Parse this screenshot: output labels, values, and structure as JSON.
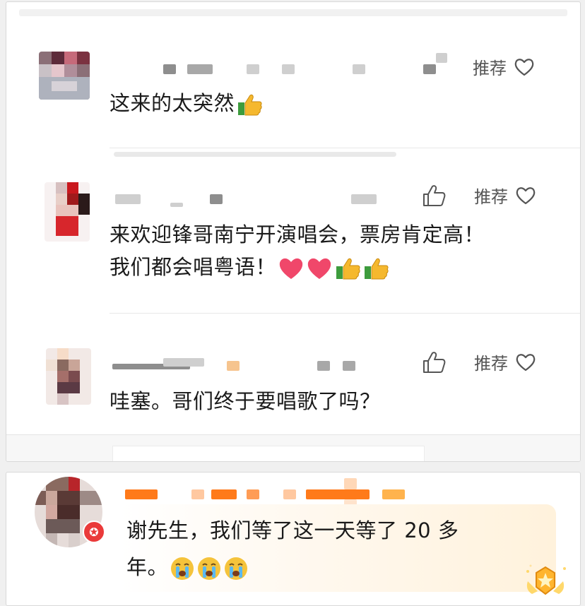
{
  "actions": {
    "like_icon": "thumbs-up-outline",
    "recommend_label": "推荐",
    "heart_icon": "heart-outline"
  },
  "comments": [
    {
      "text": "这来的太突然",
      "emoji": [
        "thumbs-up"
      ]
    },
    {
      "line1": "来欢迎锋哥南宁开演唱会，票房肯定高！",
      "line2": "我们都会唱粤语！",
      "emoji": [
        "red-heart",
        "red-heart",
        "thumbs-up",
        "thumbs-up"
      ]
    },
    {
      "text": "哇塞。哥们终于要唱歌了吗？"
    }
  ],
  "featured": {
    "line1": "谢先生，我们等了这一天等了 20 多",
    "line2": "年。",
    "emoji": [
      "crying-face",
      "crying-face",
      "crying-face"
    ],
    "badge_icon": "verified-v-icon",
    "medal_icon": "crown-medal-icon"
  },
  "colors": {
    "accent_orange": "#ff7a1a",
    "badge_red": "#ea3a3a",
    "heart_red": "#f0476a",
    "thumb_yellow": "#f5b82e"
  }
}
